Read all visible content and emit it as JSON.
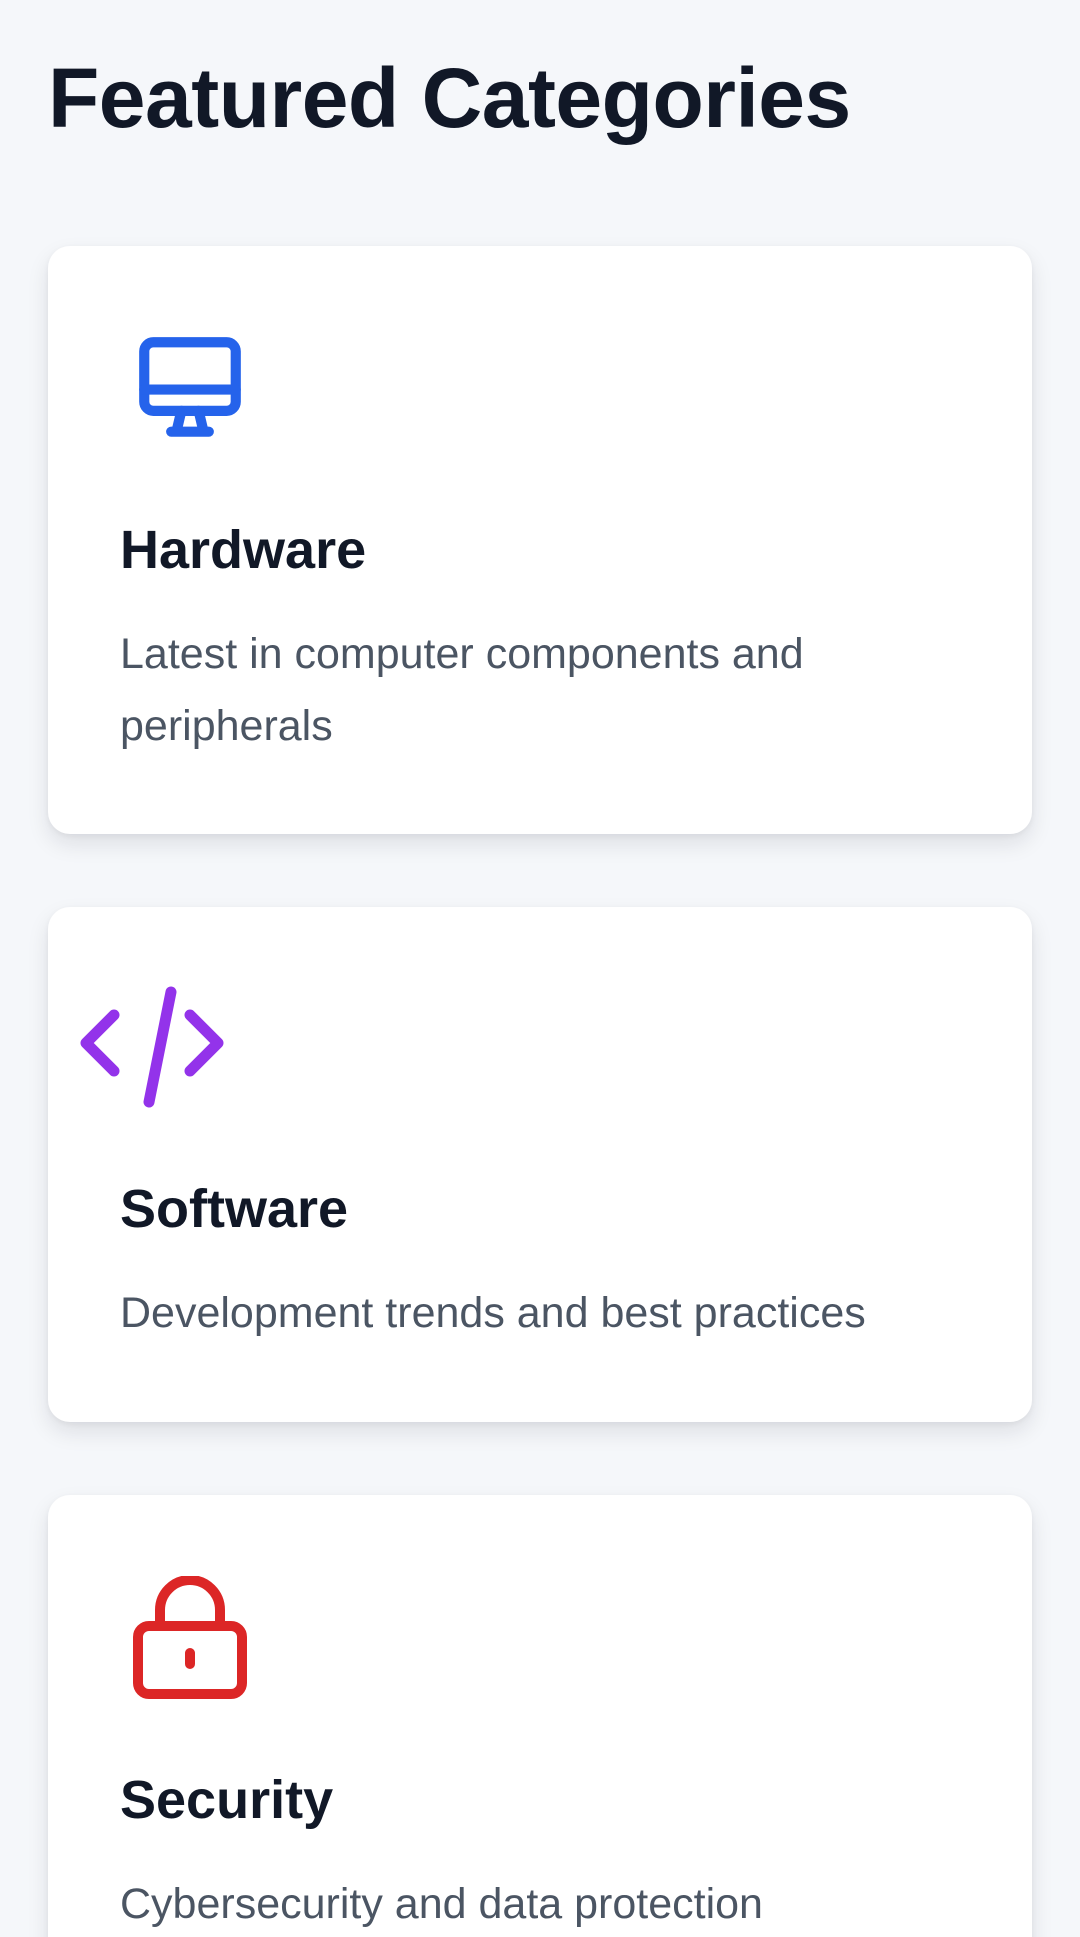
{
  "page": {
    "title": "Featured Categories"
  },
  "categories": [
    {
      "title": "Hardware",
      "description": "Latest in computer components and peripherals",
      "icon": "monitor-icon",
      "icon_color": "#2563eb"
    },
    {
      "title": "Software",
      "description": "Development trends and best practices",
      "icon": "code-icon",
      "icon_color": "#9333ea"
    },
    {
      "title": "Security",
      "description": "Cybersecurity and data protection",
      "icon": "lock-icon",
      "icon_color": "#dc2626"
    }
  ]
}
